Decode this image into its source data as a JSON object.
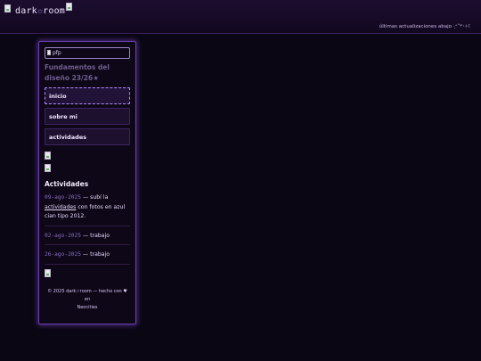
{
  "header": {
    "brand": "dark",
    "brand_star": "✩",
    "brand_suffix": "room",
    "update_note": "últimas actualizaciones abajo ·͙⁺˚*･༓☾"
  },
  "sidebar": {
    "pfp_alt": "pfp",
    "status": "Fundamentos del diseño 23/26★",
    "nav": [
      {
        "label": "inicio"
      },
      {
        "label": "sobre mi"
      },
      {
        "label": "actividades"
      }
    ],
    "activities_title": "Actividades",
    "activities": [
      {
        "date": "09-ago-2025",
        "text_before": "— subí la",
        "link": "actividades",
        "text_after": "con fotos en azul cian tipo 2012."
      },
      {
        "date": "02-ago-2025",
        "text": "— trabajo"
      },
      {
        "date": "26-ago-2025",
        "text": "— trabajo"
      }
    ],
    "footer_line1": "© 2025 dark☆room — hecho con ♥ en",
    "footer_line2": "Neocities"
  }
}
